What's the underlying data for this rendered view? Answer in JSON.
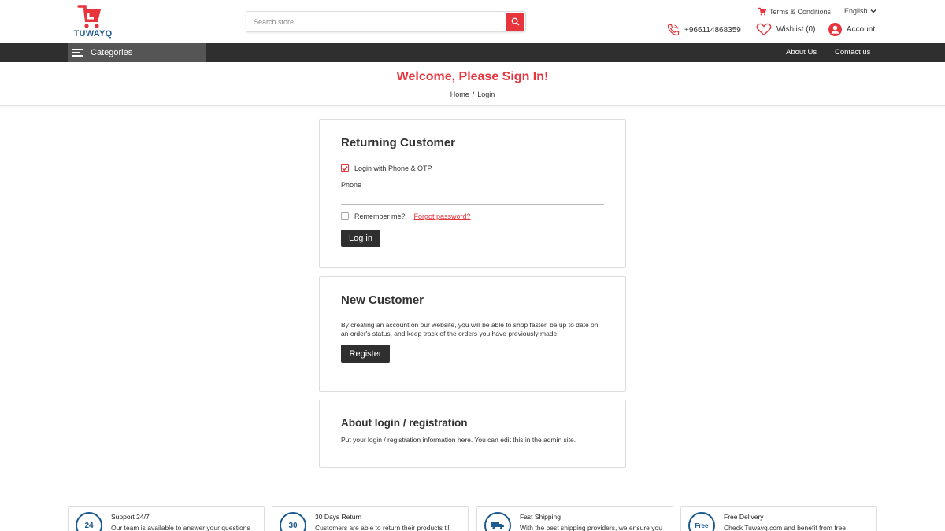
{
  "brand": {
    "name": "TUWAYQ",
    "accent": "#e7343d",
    "blue": "#1c5a8f",
    "dark": "#2f2f2f"
  },
  "header": {
    "search_placeholder": "Search store",
    "terms_label": "Terms & Conditions",
    "language": "English",
    "phone": "+966114868359",
    "wishlist_label": "Wishlist (0)",
    "account_label": "Account"
  },
  "nav": {
    "categories_label": "Categories",
    "links": [
      "About Us",
      "Contact us"
    ]
  },
  "page": {
    "title": "Welcome, Please Sign In!",
    "breadcrumb": {
      "home": "Home",
      "separator": "/",
      "current": "Login"
    }
  },
  "returning": {
    "heading": "Returning Customer",
    "phone_otp_label": "Login with Phone & OTP",
    "phone_otp_checked": true,
    "phone_label": "Phone",
    "phone_value": "",
    "remember_label": "Remember me?",
    "remember_checked": false,
    "forgot_label": "Forgot password?",
    "login_button": "Log in"
  },
  "new_customer": {
    "heading": "New Customer",
    "description_line1": "By creating an account on our website, you will be able to shop faster, be up to date on",
    "description_line2": "an order's status, and keep track of the orders you have previously made.",
    "register_button": "Register"
  },
  "about": {
    "heading": "About login / registration",
    "description": "Put your login / registration information here. You can edit this in the admin site."
  },
  "features": [
    {
      "title": "Support 24/7",
      "description": "Our team is available to answer your questions",
      "icon": "support-24-icon",
      "glyph": "24"
    },
    {
      "title": "30 Days Return",
      "description": "Customers are able to return their products till",
      "icon": "return-30-icon",
      "glyph": "30"
    },
    {
      "title": "Fast Shipping",
      "description": "With the best shipping providers, we ensure you",
      "icon": "truck-icon",
      "glyph": ""
    },
    {
      "title": "Free Delivery",
      "description": "Check Tuwayq.com and benefit from free",
      "icon": "free-delivery-icon",
      "glyph": "Free"
    }
  ]
}
